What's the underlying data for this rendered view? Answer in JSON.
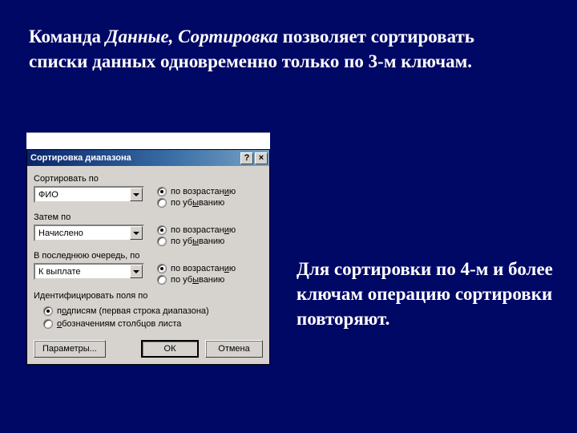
{
  "heading": {
    "pre": "Команда ",
    "italic": "Данные, Сортировка",
    "post": " позволяет сортировать списки данных одновременно только по 3-м ключам."
  },
  "side_text": "Для сортировки по 4-м и более ключам операцию сортировки повторяют.",
  "dialog": {
    "title": "Сортировка диапазона",
    "help_btn": "?",
    "close_btn": "×",
    "sort_by_label": "Сортировать по",
    "then_by_label": "Затем по",
    "last_by_label": "В последнюю очередь, по",
    "combo1": "ФИО",
    "combo2": "Начислено",
    "combo3": "К выплате",
    "asc_pre": "по возрастан",
    "asc_u": "и",
    "asc_post": "ю",
    "desc_pre": "по уб",
    "desc_u": "ы",
    "desc_post": "ванию",
    "ident_label": "Идентифицировать поля по",
    "ident_opt1_pre": "п",
    "ident_opt1_u": "о",
    "ident_opt1_post": "дписям (первая строка диапазона)",
    "ident_opt2_pre": "",
    "ident_opt2_u": "о",
    "ident_opt2_post": "бозначениям столбцов листа",
    "btn_params": "Параметры...",
    "btn_ok": "ОК",
    "btn_cancel": "Отмена"
  }
}
